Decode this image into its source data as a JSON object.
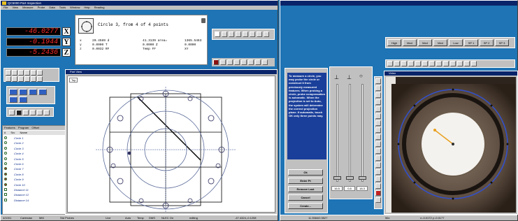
{
  "left_window": {
    "title": "QC5000 Part Inspection",
    "menu": [
      "File",
      "View",
      "Measure",
      "Probe",
      "Data",
      "Tools",
      "Window",
      "Help",
      "Reading"
    ],
    "dro": [
      {
        "value": "-46.0277",
        "axis": "X"
      },
      {
        "value": "-0.1944",
        "axis": "Y"
      },
      {
        "value": "-5.2436",
        "axis": "Z"
      }
    ],
    "measure_dialog": {
      "title": "Circle 3, from 4 of 4 points",
      "rows": [
        [
          "x",
          "20.4589 d",
          "41.3139 area=",
          "1365.5463"
        ],
        [
          "y",
          "0.0000 T",
          "0.0000 Z",
          "0.0000"
        ],
        [
          "z",
          "0.0032 RF",
          "Temp FF",
          "XY"
        ]
      ]
    },
    "feature_list": {
      "headers": [
        "Features",
        "Program",
        "Offset"
      ],
      "col_headers": [
        "#",
        "Src",
        "Name"
      ],
      "rows": [
        "Circle 1",
        "Circle 2",
        "Circle 3",
        "Circle 4",
        "Circle 5",
        "Circle 6",
        "Circle 7",
        "Circle 8",
        "Circle 9",
        "Circle 10",
        "Distance 11",
        "Distance 12",
        "Distance 14"
      ]
    },
    "view_window": {
      "title": "Part View",
      "tab": "Top"
    },
    "status": {
      "a": "4/1001",
      "b": "Cartesian",
      "c": "MM",
      "d": "Std Probes",
      "e": "Live",
      "f": "Auto",
      "g": "Temp",
      "h": "DMS",
      "i": "NLEC On",
      "j": "editing",
      "k": "-47.4324,-0.1208"
    }
  },
  "right_window": {
    "help_text": "To measure a circle, you may probe the circle or construct it from previously measured features. When probing a circle, probe compensation is automatic. When the projection is set to Auto, the system will determine the correct projection plane. If automatic, touch OK only three points may.",
    "buttons": [
      "Ok",
      "Enter Pt",
      "Remove Last",
      "Cancel",
      "Create..."
    ],
    "slider_values": [
      "16.5",
      "0.8",
      "18.3"
    ],
    "toolbar_labels": [
      "High",
      "Med",
      "Med",
      "Med",
      "Low",
      "SP 1",
      "SP 2",
      "SP 3"
    ],
    "video_title": "Video",
    "status": {
      "a": "11.3584/0.5527",
      "b": "56x",
      "c": "x:-0.0172 y:-0.0177"
    }
  }
}
